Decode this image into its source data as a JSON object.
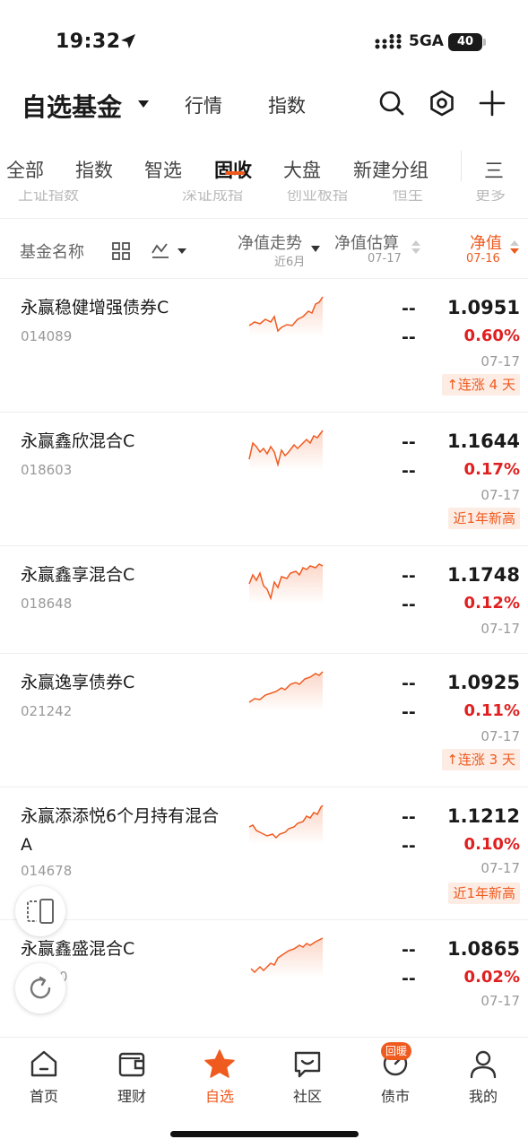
{
  "status": {
    "time": "19:32",
    "network": "5GA",
    "battery": "40"
  },
  "topnav": {
    "title": "自选基金",
    "links": [
      "行情",
      "指数"
    ]
  },
  "tabs": [
    "全部",
    "指数",
    "智选",
    "固收",
    "大盘",
    "新建分组"
  ],
  "active_tab": "固收",
  "tab_more": "三",
  "sub_strip": [
    "上证指数",
    "深证成指",
    "创业板指",
    "恒生",
    "更多"
  ],
  "header": {
    "name": "基金名称",
    "trend": "净值走势",
    "trend_sub": "近6月",
    "estimate": "净值估算",
    "estimate_date": "07-17",
    "nav": "净值",
    "nav_date": "07-16",
    "accent_color": "#ef5a1f"
  },
  "funds": [
    {
      "name": "永赢稳健增强债券C",
      "code": "014089",
      "est": "--",
      "est_change": "--",
      "nav": "1.0951",
      "change": "0.60%",
      "date": "07-17",
      "badge": "连涨 4 天",
      "badge_arrow": true
    },
    {
      "name": "永赢鑫欣混合C",
      "code": "018603",
      "est": "--",
      "est_change": "--",
      "nav": "1.1644",
      "change": "0.17%",
      "date": "07-17",
      "badge": "近1年新高",
      "badge_arrow": false
    },
    {
      "name": "永赢鑫享混合C",
      "code": "018648",
      "est": "--",
      "est_change": "--",
      "nav": "1.1748",
      "change": "0.12%",
      "date": "07-17",
      "badge": "",
      "badge_arrow": false
    },
    {
      "name": "永赢逸享债券C",
      "code": "021242",
      "est": "--",
      "est_change": "--",
      "nav": "1.0925",
      "change": "0.11%",
      "date": "07-17",
      "badge": "连涨 3 天",
      "badge_arrow": true
    },
    {
      "name": "永赢添添悦6个月持有混合A",
      "code": "014678",
      "est": "--",
      "est_change": "--",
      "nav": "1.1212",
      "change": "0.10%",
      "date": "07-17",
      "badge": "近1年新高",
      "badge_arrow": false
    },
    {
      "name": "永赢鑫盛混合C",
      "code": "0",
      "est": "--",
      "est_change": "--",
      "nav": "1.0865",
      "change": "0.02%",
      "date": "07-17",
      "badge": "",
      "badge_arrow": false
    }
  ],
  "bottom_nav": [
    {
      "label": "首页",
      "icon": "home-icon"
    },
    {
      "label": "理财",
      "icon": "wallet-icon"
    },
    {
      "label": "自选",
      "icon": "star-icon"
    },
    {
      "label": "社区",
      "icon": "chat-icon"
    },
    {
      "label": "债市",
      "icon": "bond-market-icon"
    },
    {
      "label": "我的",
      "icon": "user-icon"
    }
  ],
  "bottom_nav_active": "自选",
  "bottom_nav_badge": "回暖",
  "colors": {
    "accent": "#ef5a1f",
    "up": "#e02020",
    "text": "#1a1a1a",
    "muted": "#999999"
  }
}
